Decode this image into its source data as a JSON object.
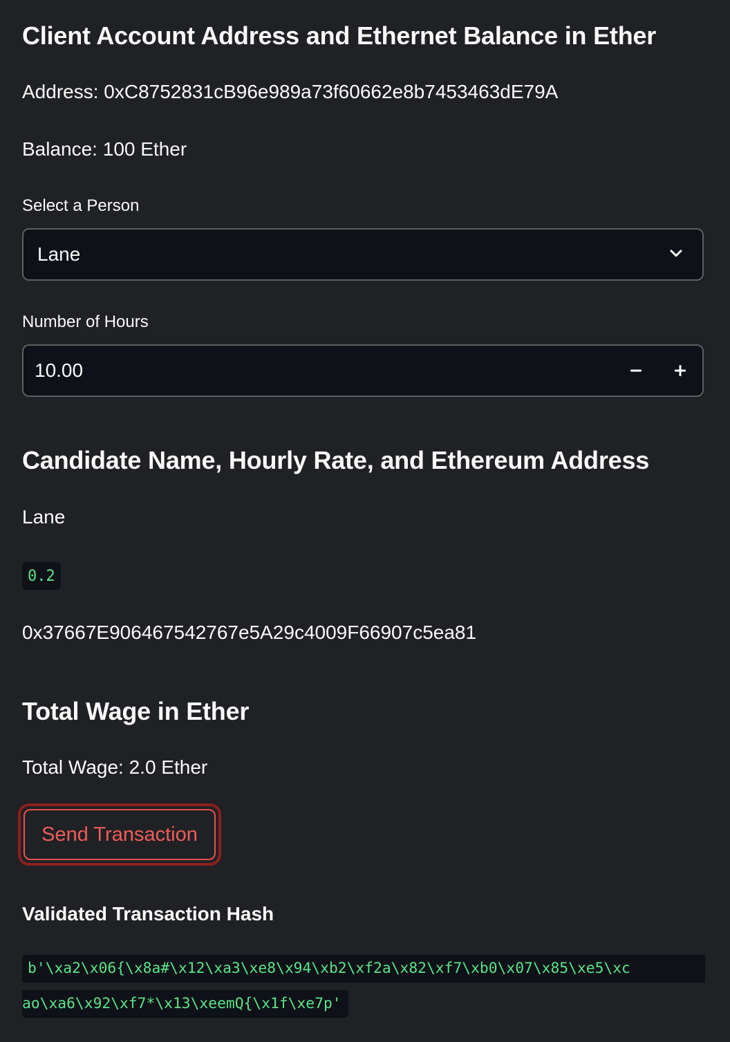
{
  "client_section": {
    "title": "Client Account Address and Ethernet Balance in Ether",
    "address_text": "Address: 0xC8752831cB96e989a73f60662e8b7453463dE79A",
    "balance_text": "Balance: 100 Ether"
  },
  "person_select": {
    "label": "Select a Person",
    "value": "Lane",
    "icon": "chevron-down-icon"
  },
  "hours_input": {
    "label": "Number of Hours",
    "value": "10.00",
    "minus_icon": "minus-icon",
    "plus_icon": "plus-icon"
  },
  "candidate_section": {
    "title": "Candidate Name, Hourly Rate, and Ethereum Address",
    "name": "Lane",
    "hourly_rate": "0.2",
    "eth_address": "0x37667E906467542767e5A29c4009F66907c5ea81"
  },
  "wage_section": {
    "title": "Total Wage in Ether",
    "total_text": "Total Wage: 2.0 Ether"
  },
  "send_button": {
    "label": "Send Transaction"
  },
  "hash_section": {
    "title": "Validated Transaction Hash",
    "line1": "b'\\xa2\\x06{\\x8a#\\x12\\xa3\\xe8\\x94\\xb2\\xf2a\\x82\\xf7\\xb0\\x07\\x85\\xe5\\xc",
    "line2": "ao\\xa6\\x92\\xf7*\\x13\\xeemQ{\\x1f\\xe7p'"
  },
  "colors": {
    "background": "#202124",
    "input_background": "#0e1117",
    "accent_red": "#ef5c5a",
    "code_green": "#5ce488"
  }
}
